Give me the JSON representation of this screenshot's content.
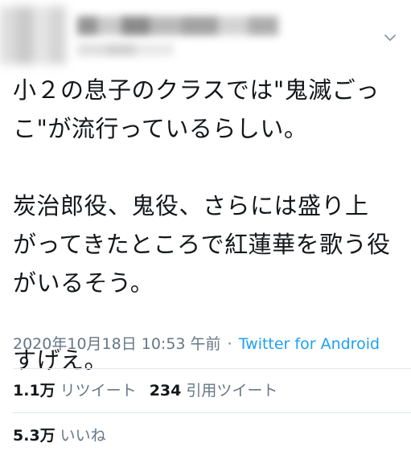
{
  "tweet": {
    "lines": [
      "小２の息子のクラスでは\"鬼滅ごっ",
      "こ\"が流行っているらしい。",
      "",
      "炭治郎役、鬼役、さらには盛り上",
      "がってきたところで紅蓮華を歌う役",
      "がいるそう。",
      "",
      "すげえ。"
    ],
    "timestamp": "2020年10月18日 10:53 午前",
    "separator": "·",
    "source": "Twitter for Android",
    "retweets_count": "1.1万",
    "retweets_label": "リツイート",
    "quotes_count": "234",
    "quotes_label": "引用ツイート",
    "likes_count": "5.3万",
    "likes_label": "いいね"
  },
  "icons": {
    "menu": "chevron-down-icon"
  },
  "colors": {
    "text": "#14171a",
    "secondary": "#657786",
    "link": "#1da1f2",
    "divider": "#e1e8ed"
  }
}
